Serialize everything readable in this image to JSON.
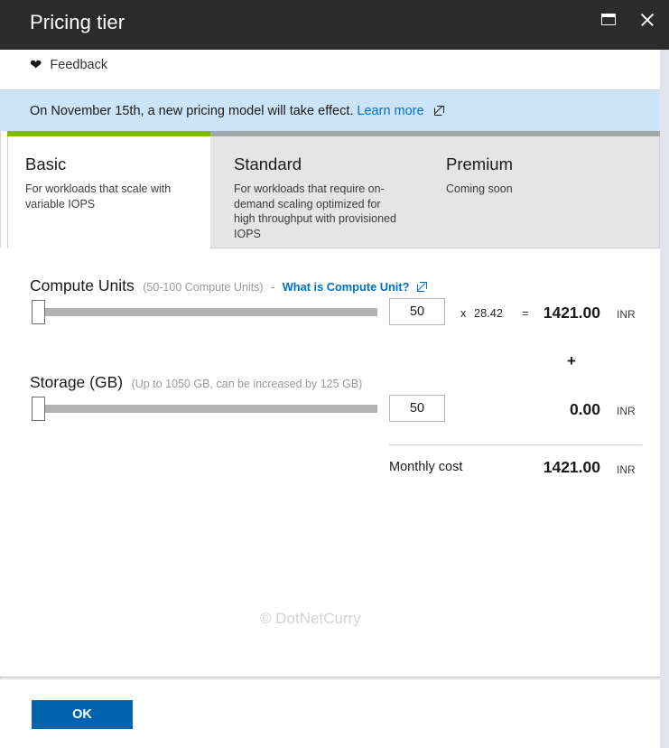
{
  "titlebar": {
    "title": "Pricing tier",
    "maximize_label": "maximize",
    "close_label": "close"
  },
  "feedback": {
    "label": "Feedback",
    "icon": "heart-icon"
  },
  "banner": {
    "message": "On November 15th, a new pricing model will take effect.",
    "link_label": "Learn more",
    "link_icon": "external-link-icon",
    "background": "#CCE4F7"
  },
  "tabs": {
    "accent_active_color": "#7FBA00",
    "accent_inactive_color": "#A0A8AC",
    "items": [
      {
        "name": "basic",
        "label": "Basic",
        "description": "For workloads that scale with variable IOPS",
        "selected": true
      },
      {
        "name": "standard",
        "label": "Standard",
        "description": "For workloads that require on-demand scaling optimized for high throughput with provisioned IOPS",
        "selected": false
      },
      {
        "name": "premium",
        "label": "Premium",
        "description": "Coming soon",
        "selected": false
      }
    ]
  },
  "compute": {
    "title": "Compute Units",
    "hint": "(50-100 Compute Units)",
    "dash": "-",
    "link_label": "What is Compute Unit?",
    "link_icon": "external-link-icon",
    "value": "50",
    "slider_min": "50",
    "slider_max": "100",
    "multiply_symbol": "x",
    "rate": "28.42",
    "equals_symbol": "=",
    "amount": "1421.00",
    "currency": "INR"
  },
  "storage": {
    "title": "Storage (GB)",
    "hint": "(Up to 1050 GB, can be increased by 125 GB)",
    "value": "50",
    "amount": "0.00",
    "currency": "INR",
    "plus_symbol": "+"
  },
  "total": {
    "label": "Monthly cost",
    "amount": "1421.00",
    "currency": "INR"
  },
  "watermark": {
    "text": "© DotNetCurry"
  },
  "footer": {
    "ok_label": "OK",
    "ok_color": "#0063B1"
  }
}
